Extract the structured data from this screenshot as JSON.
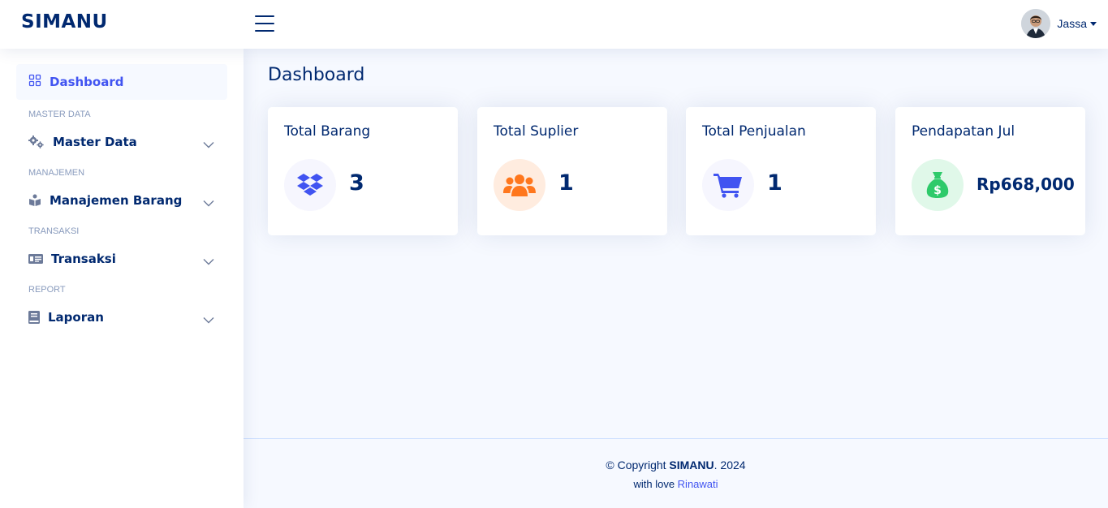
{
  "header": {
    "logo": "SIMANU",
    "user_name": "Jassa"
  },
  "sidebar": {
    "active_item": "Dashboard",
    "sections": [
      {
        "heading": "MASTER DATA",
        "item": "Master Data",
        "icon": "gears-icon"
      },
      {
        "heading": "MANAJEMEN",
        "item": "Manajemen Barang",
        "icon": "box-open-icon"
      },
      {
        "heading": "TRANSAKSI",
        "item": "Transaksi",
        "icon": "money-check-icon"
      },
      {
        "heading": "REPORT",
        "item": "Laporan",
        "icon": "book-icon"
      }
    ]
  },
  "main": {
    "title": "Dashboard",
    "cards": [
      {
        "title": "Total Barang",
        "value": "3",
        "icon": "dropbox-icon",
        "icon_color": "#4154f1",
        "bg_color": "#f6f6fe"
      },
      {
        "title": "Total Suplier",
        "value": "1",
        "icon": "users-icon",
        "icon_color": "#ff771d",
        "bg_color": "#ffecdf"
      },
      {
        "title": "Total Penjualan",
        "value": "1",
        "icon": "cart-icon",
        "icon_color": "#4154f1",
        "bg_color": "#f6f6fe"
      },
      {
        "title": "Pendapatan Jul",
        "value": "Rp668,000",
        "icon": "money-bag-icon",
        "icon_color": "#2eca6a",
        "bg_color": "#e0f8e9"
      }
    ]
  },
  "footer": {
    "copyright_prefix": "© Copyright ",
    "copyright_brand": "SIMANU",
    "copyright_suffix": ". 2024",
    "credit_prefix": "with love ",
    "credit_name": "Rinawati"
  }
}
